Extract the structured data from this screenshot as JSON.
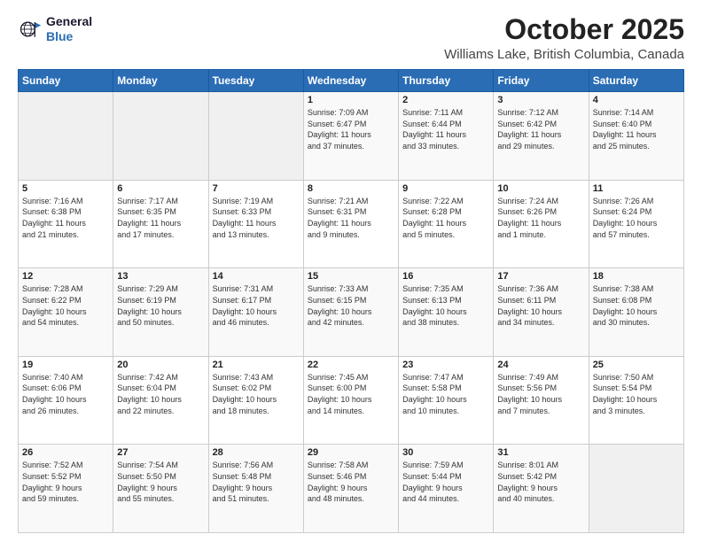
{
  "header": {
    "logo_line1": "General",
    "logo_line2": "Blue",
    "month": "October 2025",
    "location": "Williams Lake, British Columbia, Canada"
  },
  "days_of_week": [
    "Sunday",
    "Monday",
    "Tuesday",
    "Wednesday",
    "Thursday",
    "Friday",
    "Saturday"
  ],
  "weeks": [
    [
      {
        "day": "",
        "info": ""
      },
      {
        "day": "",
        "info": ""
      },
      {
        "day": "",
        "info": ""
      },
      {
        "day": "1",
        "info": "Sunrise: 7:09 AM\nSunset: 6:47 PM\nDaylight: 11 hours\nand 37 minutes."
      },
      {
        "day": "2",
        "info": "Sunrise: 7:11 AM\nSunset: 6:44 PM\nDaylight: 11 hours\nand 33 minutes."
      },
      {
        "day": "3",
        "info": "Sunrise: 7:12 AM\nSunset: 6:42 PM\nDaylight: 11 hours\nand 29 minutes."
      },
      {
        "day": "4",
        "info": "Sunrise: 7:14 AM\nSunset: 6:40 PM\nDaylight: 11 hours\nand 25 minutes."
      }
    ],
    [
      {
        "day": "5",
        "info": "Sunrise: 7:16 AM\nSunset: 6:38 PM\nDaylight: 11 hours\nand 21 minutes."
      },
      {
        "day": "6",
        "info": "Sunrise: 7:17 AM\nSunset: 6:35 PM\nDaylight: 11 hours\nand 17 minutes."
      },
      {
        "day": "7",
        "info": "Sunrise: 7:19 AM\nSunset: 6:33 PM\nDaylight: 11 hours\nand 13 minutes."
      },
      {
        "day": "8",
        "info": "Sunrise: 7:21 AM\nSunset: 6:31 PM\nDaylight: 11 hours\nand 9 minutes."
      },
      {
        "day": "9",
        "info": "Sunrise: 7:22 AM\nSunset: 6:28 PM\nDaylight: 11 hours\nand 5 minutes."
      },
      {
        "day": "10",
        "info": "Sunrise: 7:24 AM\nSunset: 6:26 PM\nDaylight: 11 hours\nand 1 minute."
      },
      {
        "day": "11",
        "info": "Sunrise: 7:26 AM\nSunset: 6:24 PM\nDaylight: 10 hours\nand 57 minutes."
      }
    ],
    [
      {
        "day": "12",
        "info": "Sunrise: 7:28 AM\nSunset: 6:22 PM\nDaylight: 10 hours\nand 54 minutes."
      },
      {
        "day": "13",
        "info": "Sunrise: 7:29 AM\nSunset: 6:19 PM\nDaylight: 10 hours\nand 50 minutes."
      },
      {
        "day": "14",
        "info": "Sunrise: 7:31 AM\nSunset: 6:17 PM\nDaylight: 10 hours\nand 46 minutes."
      },
      {
        "day": "15",
        "info": "Sunrise: 7:33 AM\nSunset: 6:15 PM\nDaylight: 10 hours\nand 42 minutes."
      },
      {
        "day": "16",
        "info": "Sunrise: 7:35 AM\nSunset: 6:13 PM\nDaylight: 10 hours\nand 38 minutes."
      },
      {
        "day": "17",
        "info": "Sunrise: 7:36 AM\nSunset: 6:11 PM\nDaylight: 10 hours\nand 34 minutes."
      },
      {
        "day": "18",
        "info": "Sunrise: 7:38 AM\nSunset: 6:08 PM\nDaylight: 10 hours\nand 30 minutes."
      }
    ],
    [
      {
        "day": "19",
        "info": "Sunrise: 7:40 AM\nSunset: 6:06 PM\nDaylight: 10 hours\nand 26 minutes."
      },
      {
        "day": "20",
        "info": "Sunrise: 7:42 AM\nSunset: 6:04 PM\nDaylight: 10 hours\nand 22 minutes."
      },
      {
        "day": "21",
        "info": "Sunrise: 7:43 AM\nSunset: 6:02 PM\nDaylight: 10 hours\nand 18 minutes."
      },
      {
        "day": "22",
        "info": "Sunrise: 7:45 AM\nSunset: 6:00 PM\nDaylight: 10 hours\nand 14 minutes."
      },
      {
        "day": "23",
        "info": "Sunrise: 7:47 AM\nSunset: 5:58 PM\nDaylight: 10 hours\nand 10 minutes."
      },
      {
        "day": "24",
        "info": "Sunrise: 7:49 AM\nSunset: 5:56 PM\nDaylight: 10 hours\nand 7 minutes."
      },
      {
        "day": "25",
        "info": "Sunrise: 7:50 AM\nSunset: 5:54 PM\nDaylight: 10 hours\nand 3 minutes."
      }
    ],
    [
      {
        "day": "26",
        "info": "Sunrise: 7:52 AM\nSunset: 5:52 PM\nDaylight: 9 hours\nand 59 minutes."
      },
      {
        "day": "27",
        "info": "Sunrise: 7:54 AM\nSunset: 5:50 PM\nDaylight: 9 hours\nand 55 minutes."
      },
      {
        "day": "28",
        "info": "Sunrise: 7:56 AM\nSunset: 5:48 PM\nDaylight: 9 hours\nand 51 minutes."
      },
      {
        "day": "29",
        "info": "Sunrise: 7:58 AM\nSunset: 5:46 PM\nDaylight: 9 hours\nand 48 minutes."
      },
      {
        "day": "30",
        "info": "Sunrise: 7:59 AM\nSunset: 5:44 PM\nDaylight: 9 hours\nand 44 minutes."
      },
      {
        "day": "31",
        "info": "Sunrise: 8:01 AM\nSunset: 5:42 PM\nDaylight: 9 hours\nand 40 minutes."
      },
      {
        "day": "",
        "info": ""
      }
    ]
  ]
}
